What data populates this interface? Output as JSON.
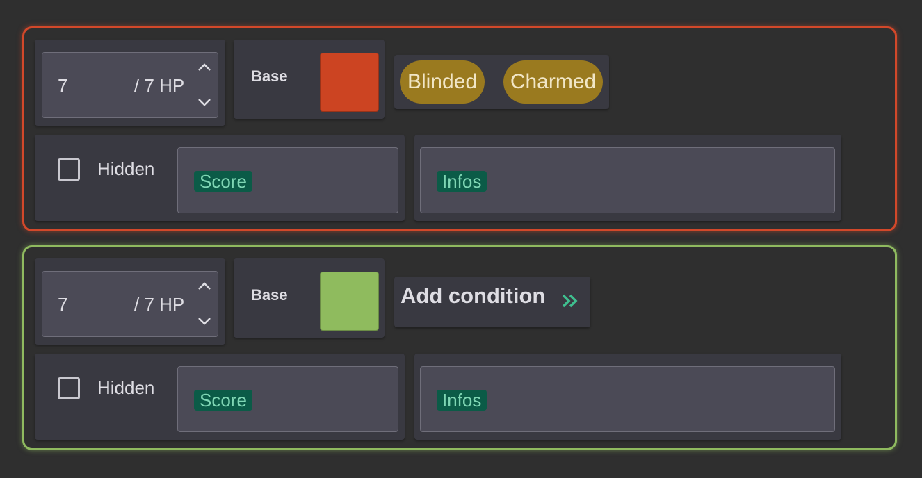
{
  "cards": [
    {
      "border_color": "#d2482a",
      "glow_color": "rgba(210,72,42,0.55)",
      "hp": {
        "current": "7",
        "max_label": "/ 7 HP"
      },
      "base": {
        "label": "Base",
        "color": "#cc4422"
      },
      "conditions": [
        "Blinded",
        "Charmed"
      ],
      "hidden": {
        "label": "Hidden",
        "checked": false
      },
      "score": {
        "tag": "Score"
      },
      "infos": {
        "tag": "Infos"
      }
    },
    {
      "border_color": "#8fba5f",
      "glow_color": "rgba(143,186,95,0.55)",
      "hp": {
        "current": "7",
        "max_label": "/ 7 HP"
      },
      "base": {
        "label": "Base",
        "color": "#8fbb5e"
      },
      "add_condition": {
        "label": "Add condition",
        "icon": "double-chevron-right-icon",
        "icon_color": "#3fbf8f"
      },
      "hidden": {
        "label": "Hidden",
        "checked": false
      },
      "score": {
        "tag": "Score"
      },
      "infos": {
        "tag": "Infos"
      }
    }
  ]
}
